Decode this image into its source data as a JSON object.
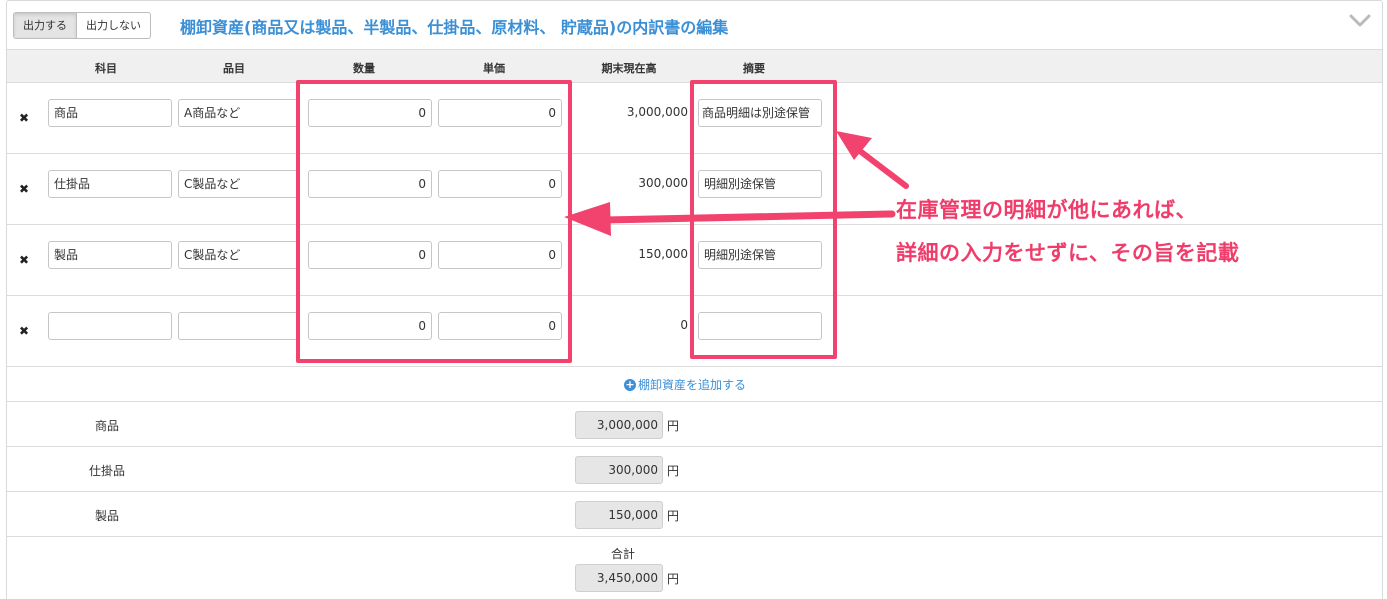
{
  "header": {
    "output_on_label": "出力する",
    "output_off_label": "出力しない",
    "title": "棚卸資産(商品又は製品、半製品、仕掛品、原材料、 貯蔵品)の内訳書の編集"
  },
  "columns": {
    "subject": "科目",
    "item": "品目",
    "quantity": "数量",
    "unit_price": "単価",
    "closing_balance": "期末現在高",
    "summary": "摘要"
  },
  "rows": [
    {
      "subject": "商品",
      "item": "A商品など",
      "quantity": "0",
      "unit_price": "0",
      "amount": "3,000,000",
      "summary": "商品明細は別途保管"
    },
    {
      "subject": "仕掛品",
      "item": "C製品など",
      "quantity": "0",
      "unit_price": "0",
      "amount": "300,000",
      "summary": "明細別途保管"
    },
    {
      "subject": "製品",
      "item": "C製品など",
      "quantity": "0",
      "unit_price": "0",
      "amount": "150,000",
      "summary": "明細別途保管"
    },
    {
      "subject": "",
      "item": "",
      "quantity": "0",
      "unit_price": "0",
      "amount": "0",
      "summary": ""
    }
  ],
  "add_link_label": "棚卸資産を追加する",
  "subtotals": [
    {
      "label": "商品",
      "value": "3,000,000",
      "unit": "円"
    },
    {
      "label": "仕掛品",
      "value": "300,000",
      "unit": "円"
    },
    {
      "label": "製品",
      "value": "150,000",
      "unit": "円"
    }
  ],
  "total": {
    "label": "合計",
    "value": "3,450,000",
    "unit": "円"
  },
  "annotation": {
    "line1": "在庫管理の明細が他にあれば、",
    "line2": "詳細の入力をせずに、その旨を記載",
    "color": "#f2436f"
  },
  "colors": {
    "accent": "#3a8fd6",
    "highlight": "#f2436f"
  }
}
